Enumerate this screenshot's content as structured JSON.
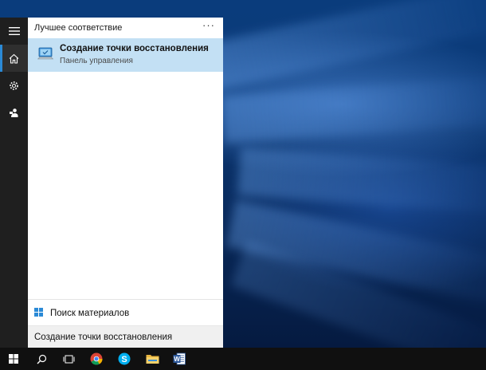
{
  "search_panel": {
    "section_title": "Лучшее соответствие",
    "more_label": "···",
    "best_match": {
      "title": "Создание точки восстановления",
      "subtitle": "Панель управления",
      "icon": "system-restore-icon"
    },
    "web_search_label": "Поиск материалов",
    "query": "Создание точки восстановления"
  },
  "rail": {
    "items": [
      "hamburger-menu",
      "home",
      "settings",
      "feedback"
    ]
  },
  "taskbar": {
    "items": [
      "start",
      "search",
      "task-view",
      "chrome",
      "skype",
      "file-explorer",
      "word"
    ]
  },
  "colors": {
    "accent": "#2b8ad6",
    "selection": "#c3e0f4",
    "rail_bg": "#1f1f1f",
    "taskbar_bg": "#101010"
  }
}
